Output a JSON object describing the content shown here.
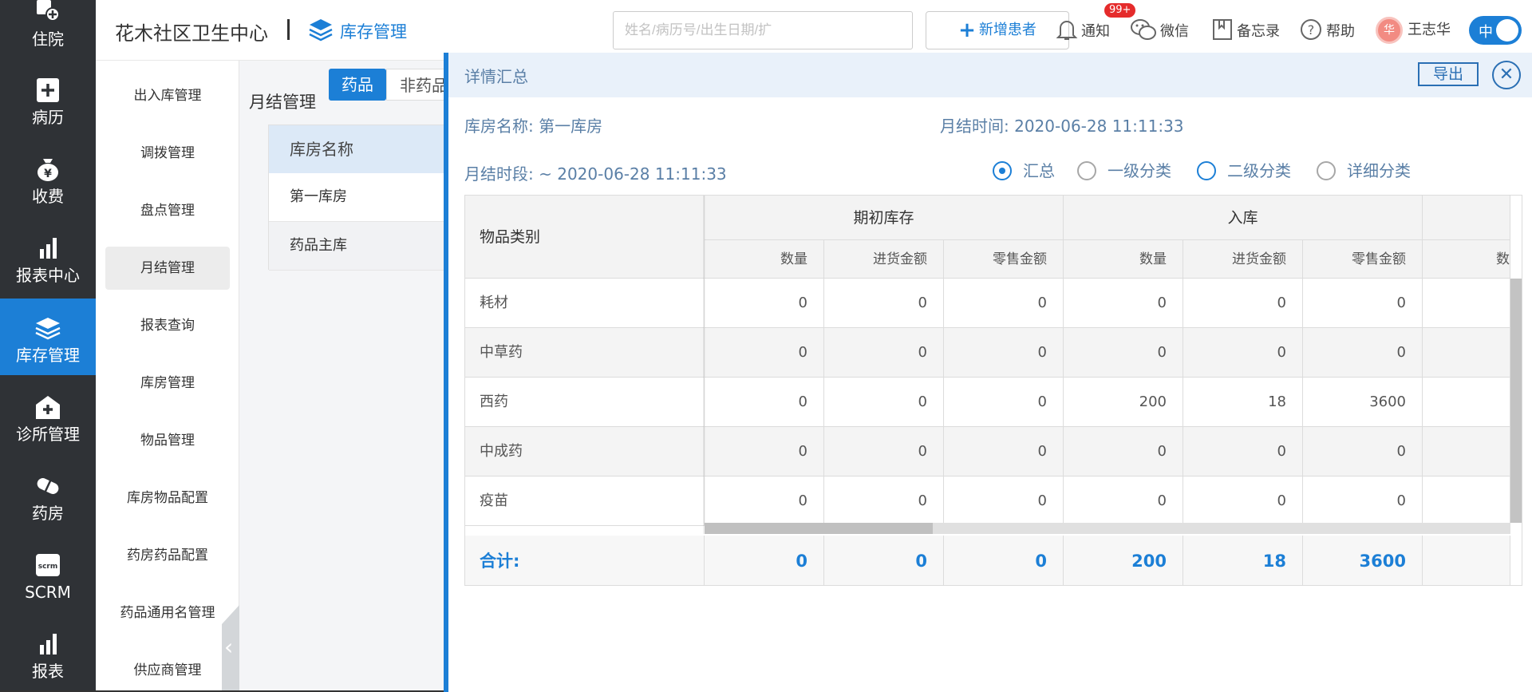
{
  "sidebar": {
    "items": [
      {
        "label": "住院",
        "icon": "hospital-admission-icon",
        "active": false
      },
      {
        "label": "病历",
        "icon": "medical-record-icon",
        "active": false
      },
      {
        "label": "收费",
        "icon": "money-bag-icon",
        "active": false
      },
      {
        "label": "报表中心",
        "icon": "bar-chart-icon",
        "active": false
      },
      {
        "label": "库存管理",
        "icon": "layers-icon",
        "active": true
      },
      {
        "label": "诊所管理",
        "icon": "clinic-icon",
        "active": false
      },
      {
        "label": "药房",
        "icon": "pill-icon",
        "active": false
      },
      {
        "label": "SCRM",
        "icon": "scrm-icon",
        "active": false
      },
      {
        "label": "报表",
        "icon": "bar-chart-icon",
        "active": false
      }
    ]
  },
  "subnav": {
    "items": [
      "出入库管理",
      "调拨管理",
      "盘点管理",
      "月结管理",
      "报表查询",
      "库房管理",
      "物品管理",
      "库房物品配置",
      "药房药品配置",
      "药品通用名管理",
      "供应商管理"
    ],
    "selected": "月结管理"
  },
  "header": {
    "title": "花木社区卫生中心",
    "module": "库存管理",
    "search_placeholder": "姓名/病历号/出生日期/扩",
    "add_patient": "新增患者",
    "notify": "通知",
    "notify_badge": "99+",
    "wechat": "微信",
    "memo": "备忘录",
    "help": "帮助",
    "user": "王志华",
    "avatar_char": "华",
    "toggle_label": "中"
  },
  "main": {
    "page_title": "月结管理",
    "tabs": [
      "药品",
      "非药品"
    ],
    "bg_table": {
      "header": "库房名称",
      "rows": [
        "第一库房",
        "药品主库"
      ]
    }
  },
  "panel": {
    "title": "详情汇总",
    "export": "导出",
    "close": "✕",
    "warehouse_label": "库房名称:",
    "warehouse_value": "第一库房",
    "settle_time_label": "月结时间:",
    "settle_time_value": "2020-06-28 11:11:33",
    "period_label": "月结时段:",
    "period_value": "~ 2020-06-28 11:11:33",
    "radios": [
      {
        "label": "汇总",
        "checked": true
      },
      {
        "label": "一级分类",
        "checked": false
      },
      {
        "label": "二级分类",
        "checked": false
      },
      {
        "label": "详细分类",
        "checked": false
      }
    ],
    "table": {
      "category_header": "物品类别",
      "groups": [
        "期初库存",
        "入库"
      ],
      "subheaders": [
        "数量",
        "进货金额",
        "零售金额",
        "数量",
        "进货金额",
        "零售金额",
        "数"
      ],
      "rows": [
        {
          "name": "耗材",
          "values": [
            "0",
            "0",
            "0",
            "0",
            "0",
            "0"
          ]
        },
        {
          "name": "中草药",
          "values": [
            "0",
            "0",
            "0",
            "0",
            "0",
            "0"
          ]
        },
        {
          "name": "西药",
          "values": [
            "0",
            "0",
            "0",
            "200",
            "18",
            "3600"
          ]
        },
        {
          "name": "中成药",
          "values": [
            "0",
            "0",
            "0",
            "0",
            "0",
            "0"
          ]
        },
        {
          "name": "疫苗",
          "values": [
            "0",
            "0",
            "0",
            "0",
            "0",
            "0"
          ]
        }
      ],
      "total_label": "合计:",
      "total_values": [
        "0",
        "0",
        "0",
        "200",
        "18",
        "3600"
      ]
    }
  },
  "colors": {
    "primary": "#1c7fd6",
    "sidebar": "#2f3236",
    "panel_text": "#5a7fa6"
  }
}
